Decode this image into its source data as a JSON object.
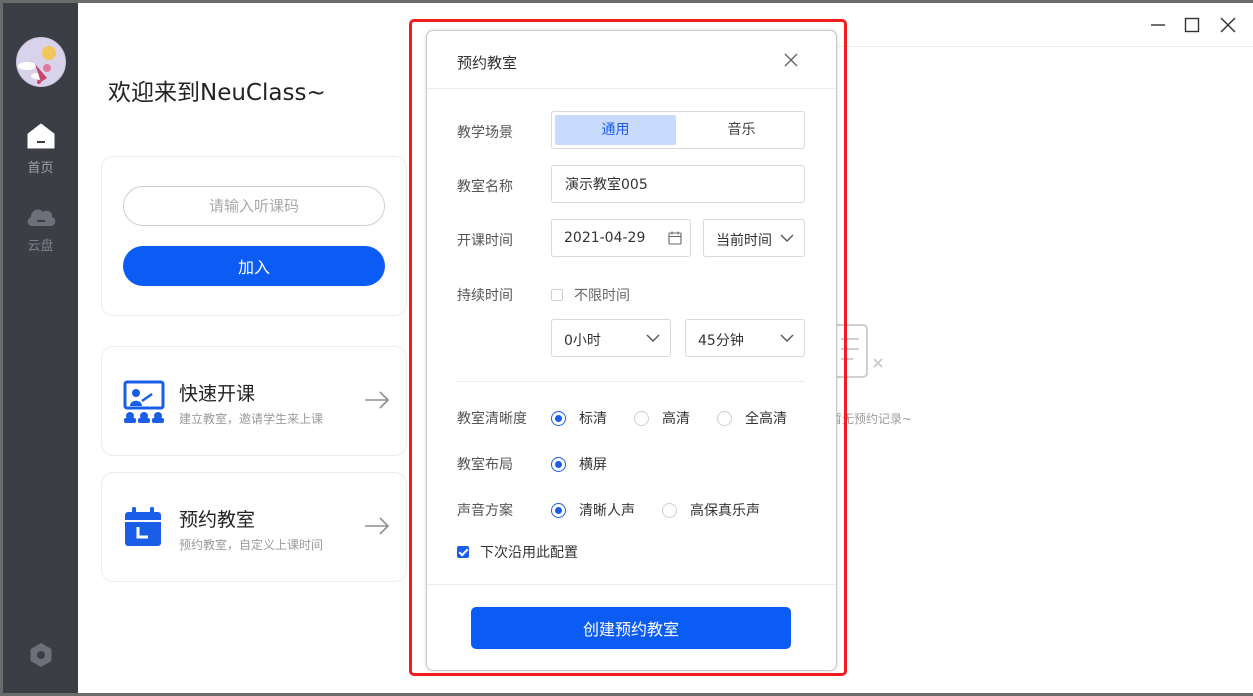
{
  "sidebar": {
    "home_label": "首页",
    "cloud_label": "云盘"
  },
  "left_panel": {
    "welcome": "欢迎来到NeuClass~",
    "join": {
      "placeholder": "请输入听课码",
      "button": "加入"
    },
    "quick_class": {
      "title": "快速开课",
      "subtitle": "建立教室，邀请学生来上课"
    },
    "book_class": {
      "title": "预约教室",
      "subtitle": "预约教室，自定义上课时间"
    }
  },
  "right_area": {
    "empty_text": "暂无预约记录~"
  },
  "dialog": {
    "title": "预约教室",
    "scene_label": "教学场景",
    "scene_options": [
      "通用",
      "音乐"
    ],
    "scene_selected": "通用",
    "name_label": "教室名称",
    "name_value": "演示教室005",
    "start_label": "开课时间",
    "start_date": "2021-04-29",
    "start_time": "当前时间",
    "duration_label": "持续时间",
    "unlimited_label": "不限时间",
    "unlimited_checked": false,
    "duration_hours": "0小时",
    "duration_minutes": "45分钟",
    "clarity_label": "教室清晰度",
    "clarity_options": [
      "标清",
      "高清",
      "全高清"
    ],
    "clarity_selected": "标清",
    "layout_label": "教室布局",
    "layout_options": [
      "横屏"
    ],
    "layout_selected": "横屏",
    "sound_label": "声音方案",
    "sound_options": [
      "清晰人声",
      "高保真乐声"
    ],
    "sound_selected": "清晰人声",
    "reuse_label": "下次沿用此配置",
    "reuse_checked": true,
    "submit": "创建预约教室"
  },
  "colors": {
    "primary": "#0b5cf5",
    "sidebar_bg": "#3c3e46",
    "highlight": "#f01d1d",
    "segment_active_bg": "#c8dbff"
  },
  "icons": {
    "home": "home-icon",
    "cloud": "cloud-icon",
    "settings": "settings-icon",
    "quick_class": "teacher-board-icon",
    "book_class": "calendar-icon",
    "arrow": "arrow-right-icon",
    "date": "calendar-small-icon",
    "dropdown": "chevron-down-icon",
    "close": "close-icon"
  }
}
